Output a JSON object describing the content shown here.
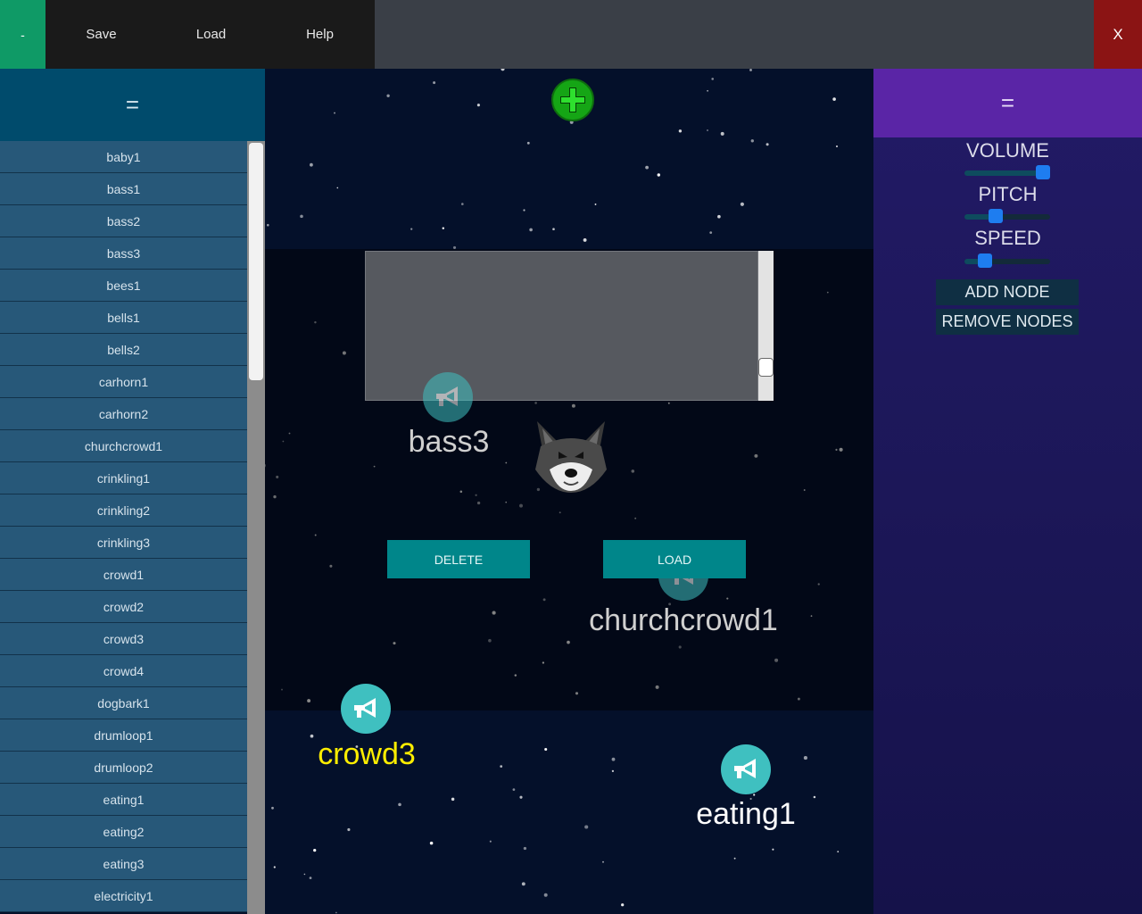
{
  "topbar": {
    "minus_label": "-",
    "menu": [
      "Save",
      "Load",
      "Help"
    ],
    "close_label": "X"
  },
  "left_panel": {
    "header_icon": "=",
    "sounds": [
      "baby1",
      "bass1",
      "bass2",
      "bass3",
      "bees1",
      "bells1",
      "bells2",
      "carhorn1",
      "carhorn2",
      "churchcrowd1",
      "crinkling1",
      "crinkling2",
      "crinkling3",
      "crowd1",
      "crowd2",
      "crowd3",
      "crowd4",
      "dogbark1",
      "drumloop1",
      "drumloop2",
      "eating1",
      "eating2",
      "eating3",
      "electricity1"
    ]
  },
  "center": {
    "add_icon": "plus-icon",
    "delete_label": "DELETE",
    "load_label": "LOAD",
    "nodes": [
      {
        "label": "bass3",
        "color": "#cfcfcf",
        "icon": "megaphone-icon"
      },
      {
        "label": "churchcrowd1",
        "color": "#cfcfcf",
        "icon": "megaphone-icon"
      },
      {
        "label": "crowd3",
        "color": "#ffee00",
        "icon": "megaphone-icon"
      },
      {
        "label": "eating1",
        "color": "#ffffff",
        "icon": "megaphone-icon"
      }
    ],
    "avatar_icon": "wolf-icon"
  },
  "right_panel": {
    "header_icon": "=",
    "sliders": [
      {
        "label": "VOLUME",
        "value": 0.92
      },
      {
        "label": "PITCH",
        "value": 0.36
      },
      {
        "label": "SPEED",
        "value": 0.24
      }
    ],
    "add_node_label": "ADD NODE",
    "remove_nodes_label": "REMOVE NODES"
  },
  "colors": {
    "accent_green": "#0f9a66",
    "close_red": "#8b1414",
    "list_blue": "#275879",
    "teal_button": "#00868a",
    "panel_purple": "#5a25a6",
    "selected_label": "#ffee00"
  }
}
